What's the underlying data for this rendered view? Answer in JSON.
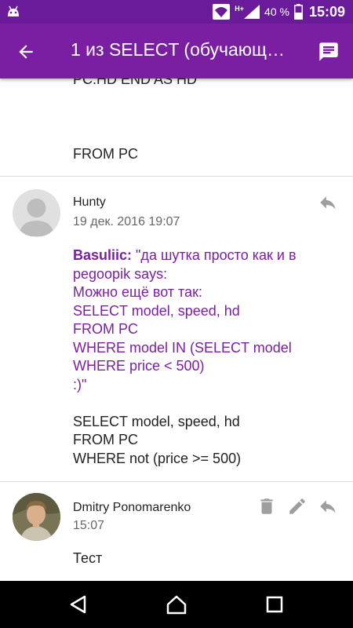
{
  "status_bar": {
    "network_label": "H+",
    "battery": "40 %",
    "time": "15:09",
    "icons": [
      "android-icon",
      "wifi-icon",
      "signal-icon",
      "battery-icon"
    ]
  },
  "app_bar": {
    "title": "1 из SELECT (обучающ…",
    "back_icon": "arrow-back-icon",
    "action_icon": "message-icon"
  },
  "previous_post": {
    "lines": [
      "PC.HD END AS HD",
      "FROM PC"
    ]
  },
  "posts": [
    {
      "author": "Hunty",
      "date": "19 дек. 2016 19:07",
      "avatar": "default-avatar",
      "actions": [
        "reply-icon"
      ],
      "quote_author": "Basuliic:",
      "quote_lines": [
        "\"да шутка просто как и в",
        "pegoopik says:",
        "Можно ещё вот так:",
        "SELECT model, speed, hd",
        "FROM PC",
        "WHERE model IN (SELECT model",
        "WHERE price < 500)",
        ":)\""
      ],
      "body_lines": [
        "SELECT model, speed, hd",
        "FROM PC",
        "WHERE not (price >= 500)"
      ]
    },
    {
      "author": "Dmitry Ponomarenko",
      "date": "15:07",
      "avatar": "user-photo-avatar",
      "actions": [
        "delete-icon",
        "edit-icon",
        "reply-icon"
      ],
      "body_lines": [
        "Тест"
      ]
    }
  ],
  "colors": {
    "status_bar": "#6a1b9a",
    "app_bar": "#7b1fa2",
    "quote_text": "#7b1fa2",
    "action_icon": "#9e9e9e"
  },
  "nav_bar": {
    "icons": [
      "back-nav-icon",
      "home-nav-icon",
      "recents-nav-icon"
    ]
  }
}
